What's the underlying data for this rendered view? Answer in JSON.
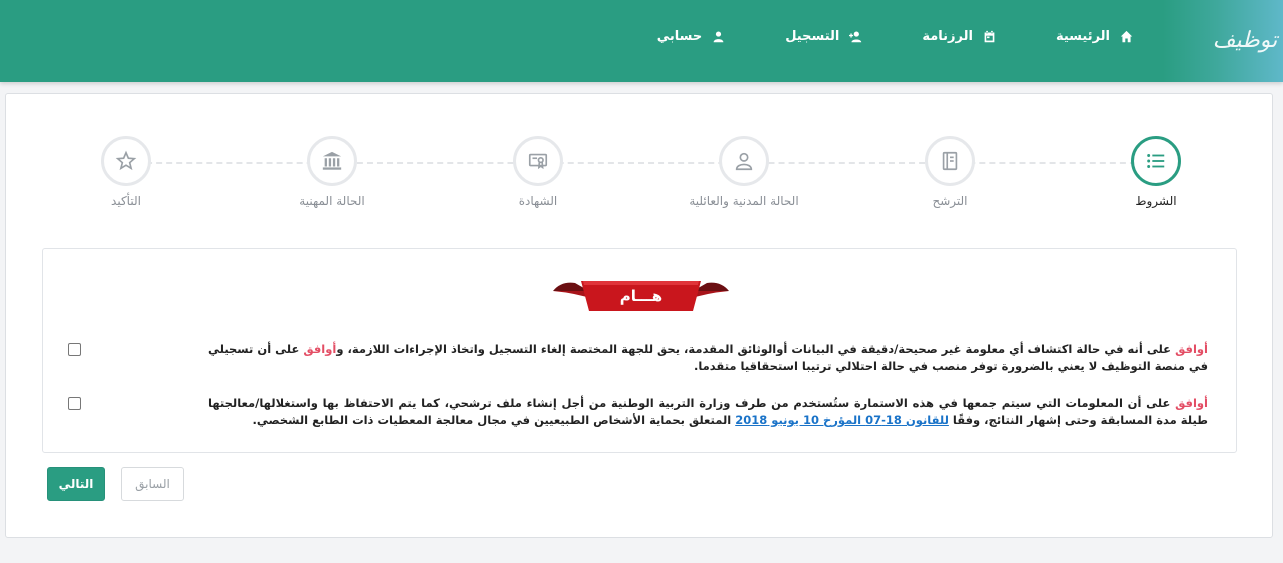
{
  "header": {
    "logo_text": "توظيف",
    "nav": [
      {
        "label": "الرئيسية",
        "icon": "home-icon"
      },
      {
        "label": "الرزنامة",
        "icon": "calendar-icon"
      },
      {
        "label": "التسجيل",
        "icon": "user-plus-icon"
      },
      {
        "label": "حسابي",
        "icon": "user-icon"
      }
    ]
  },
  "stepper": {
    "steps": [
      {
        "label": "الشروط",
        "icon": "list-icon",
        "active": true
      },
      {
        "label": "الترشح",
        "icon": "notebook-icon",
        "active": false
      },
      {
        "label": "الحالة المدنية والعائلية",
        "icon": "person-icon",
        "active": false
      },
      {
        "label": "الشهادة",
        "icon": "certificate-icon",
        "active": false
      },
      {
        "label": "الحالة المهنية",
        "icon": "bank-icon",
        "active": false
      },
      {
        "label": "التأكيد",
        "icon": "star-icon",
        "active": false
      }
    ]
  },
  "terms": {
    "banner": "هـــام",
    "items": [
      {
        "agree1": "أوافق",
        "text1": " على أنه في حالة اكتشاف أي معلومة غير صحيحة/دقيقة في البيانات أوالوثائق المقدمة، يحق للجهة المختصة إلغاء التسجيل واتخاذ الإجراءات اللازمة، و",
        "agree2": "أوافق",
        "text2": " على أن تسجيلي في منصة التوظيف لا يعني بالضرورة توفر منصب في حالة احتلالي ترتيبا استحقاقيا متقدما.",
        "checked": false
      },
      {
        "agree1": "أوافق",
        "text1": " على أن المعلومات التي سيتم جمعها في هذه الاستمارة ستُستخدم من طرف وزارة التربية الوطنية من أجل إنشاء ملف ترشحي، كما يتم الاحتفاظ بها واستغلالها/معالجتها طيلة مدة المسابقة وحتى إشهار النتائج، وفقًا ",
        "law": "للقانون 18-07 المؤرخ 10 يونيو 2018",
        "text2": " المتعلق بحماية الأشخاص الطبيعيين في مجال معالجة المعطيات ذات الطابع الشخصي.",
        "checked": false
      }
    ]
  },
  "buttons": {
    "next": "التالي",
    "prev": "السابق"
  },
  "colors": {
    "primary": "#2a9d82",
    "accent_red": "#e34d64",
    "ribbon_red": "#c9161d",
    "link_blue": "#1a73c8"
  }
}
